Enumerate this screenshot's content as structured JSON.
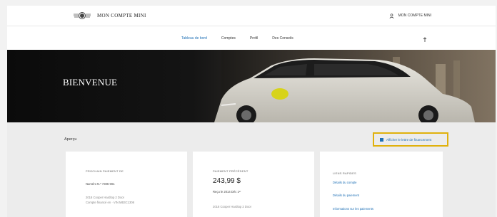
{
  "header": {
    "brand": "MON COMPTE MINI",
    "account_label": "MON COMPTE MINI"
  },
  "nav": {
    "items": [
      {
        "label": "Tableau de bord",
        "active": true
      },
      {
        "label": "Comptes",
        "active": false
      },
      {
        "label": "Profil",
        "active": false
      },
      {
        "label": "Des Conseils",
        "active": false
      }
    ]
  },
  "hero": {
    "title": "BIENVENUE"
  },
  "overview": {
    "title": "Aperçu",
    "view_all_label": "Afficher le lettre de financement"
  },
  "cards": {
    "financing": {
      "title": "PROCHAIN PAIEMENT DE",
      "account_number": "Numéro N.º 7305-001",
      "line1": "2018 Cooper Hardtop 2 Door",
      "line2": "Compte financé en · VIN MB3C1308"
    },
    "payment": {
      "title": "PAIEMENT PRÉCÉDENT",
      "amount": "243,99 $",
      "due": "Reçu le 2014 Déc 1ᵉʳ",
      "line1": "2018 Cooper Hardtop 2 Door"
    },
    "links": {
      "title": "LIENS RAPIDES",
      "items": [
        "Détails du compte",
        "Détails du paiement",
        "Informations sur les paiements"
      ]
    }
  },
  "colors": {
    "accent": "#1d6fb5",
    "highlight_border": "#e0b10c",
    "hero_dark": "#0b0b0b"
  }
}
